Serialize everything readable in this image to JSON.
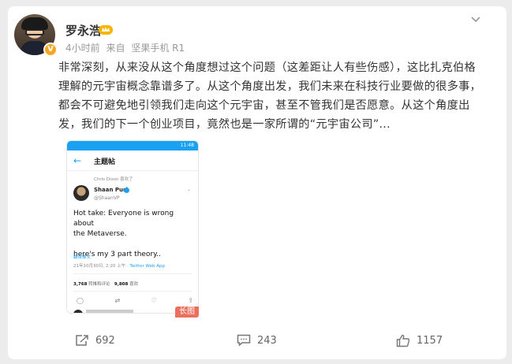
{
  "user": {
    "name": "罗永浩",
    "time": "4小时前",
    "source_prefix": "来自",
    "source": "坚果手机 R1"
  },
  "post": {
    "lines": [
      "非常深刻，从来没从这个角度想过这个问题（这差距让人有些伤感），这比扎克伯格",
      "理解的元宇宙概念靠谱多了。从这个角度出发，我们未来在科技行业要做的很多事，",
      "都会不可避免地引领我们走向这个元宇宙，甚至不管我们是否愿意。从这个角度出",
      "发，我们的下一个创业项目，竟然也是一家所谓的“元宇宙公司”..."
    ]
  },
  "screenshot": {
    "status_time": "11:48",
    "header_title": "主题帖",
    "liked_by": "Chris Dixon 喜欢了",
    "author_name": "Shaan Puri",
    "author_handle": "@ShaanVP",
    "body_line1": "Hot take: Everyone is wrong about",
    "body_line2": "the Metaverse.",
    "body_line3": "here's my 3 part theory..",
    "translate": "翻译推文",
    "date": "21年10月30日, 2:20 上午 · ",
    "client": "Twitter Web App",
    "retweets_count": "3,768",
    "retweets_label": "转推和评论",
    "likes_count": "9,808",
    "likes_label": "喜欢",
    "long_badge": "长图"
  },
  "actions": {
    "forward_count": "692",
    "comment_count": "243",
    "like_count": "1157"
  },
  "colors": {
    "twitter_blue": "#1da1f2",
    "badge_orange": "#f5a623",
    "long_badge_red": "#eb6f5d"
  }
}
